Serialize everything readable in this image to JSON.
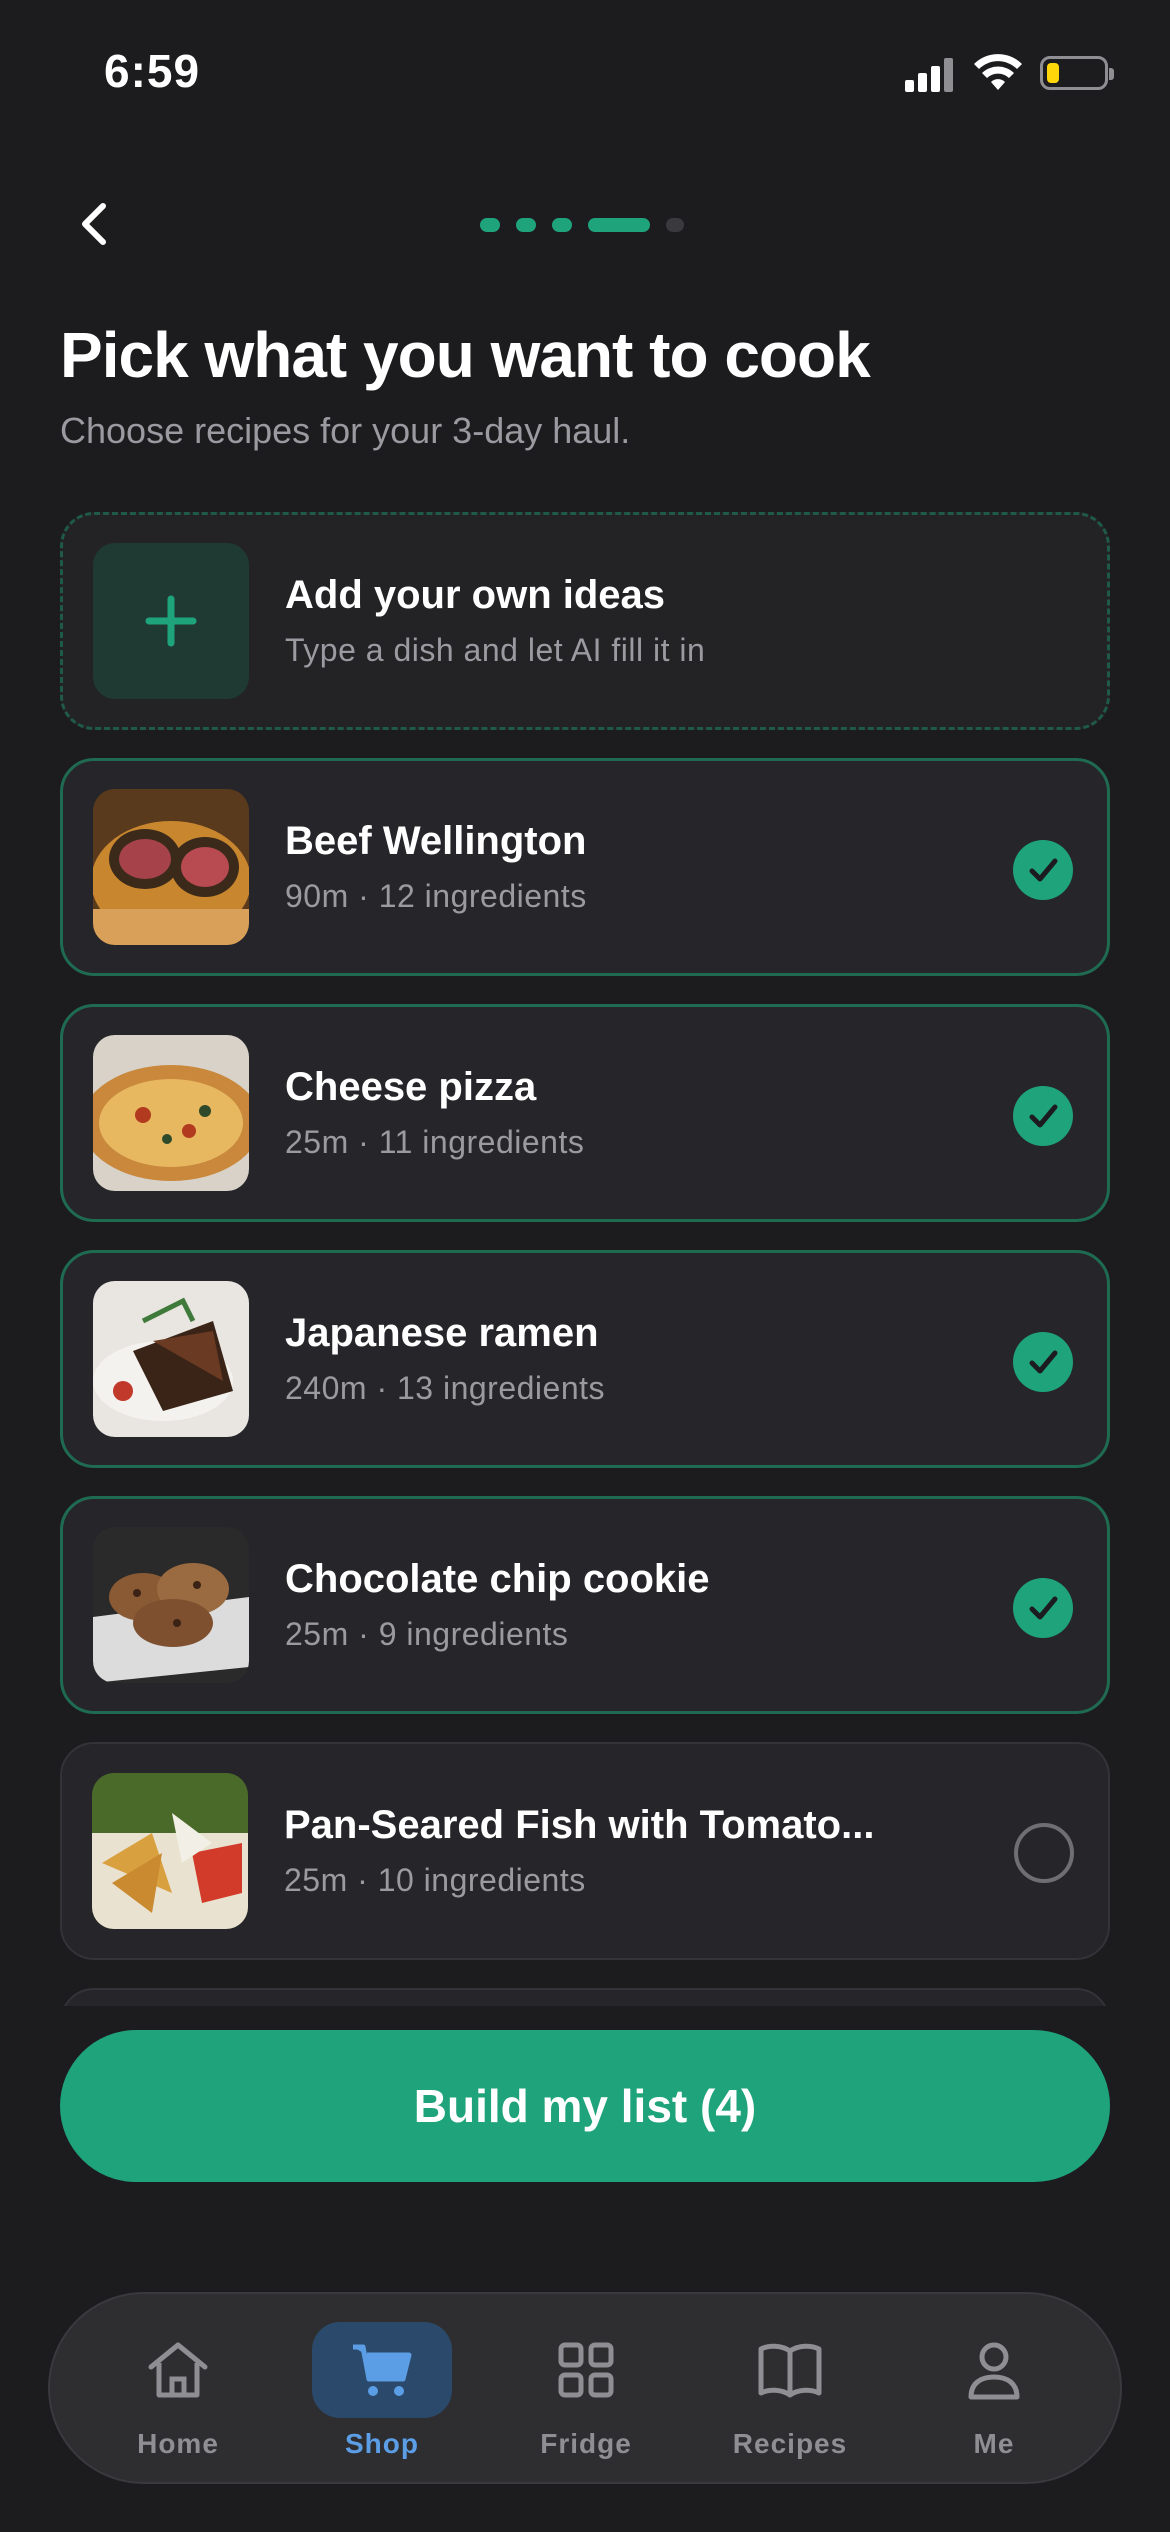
{
  "status_bar": {
    "time": "6:59"
  },
  "header": {
    "title": "Pick what you want to cook",
    "subtitle": "Choose recipes for your 3-day haul.",
    "progress": {
      "total_steps": 5,
      "current_step": 4
    }
  },
  "add_card": {
    "title": "Add your own ideas",
    "subtitle": "Type a dish and let AI fill it in"
  },
  "recipes": [
    {
      "name": "Beef Wellington",
      "meta": "90m · 12 ingredients",
      "selected": true
    },
    {
      "name": "Cheese pizza",
      "meta": "25m · 11 ingredients",
      "selected": true
    },
    {
      "name": "Japanese ramen",
      "meta": "240m · 13 ingredients",
      "selected": true
    },
    {
      "name": "Chocolate chip cookie",
      "meta": "25m · 9 ingredients",
      "selected": true
    },
    {
      "name": "Pan-Seared Fish with Tomato...",
      "meta": "25m · 10 ingredients",
      "selected": false
    }
  ],
  "cta": {
    "label": "Build my list (4)"
  },
  "tabbar": {
    "items": [
      {
        "label": "Home",
        "icon": "house-icon",
        "active": false
      },
      {
        "label": "Shop",
        "icon": "cart-icon",
        "active": true
      },
      {
        "label": "Fridge",
        "icon": "grid-icon",
        "active": false
      },
      {
        "label": "Recipes",
        "icon": "book-icon",
        "active": false
      },
      {
        "label": "Me",
        "icon": "person-icon",
        "active": false
      }
    ]
  },
  "colors": {
    "background": "#1c1c1e",
    "accent": "#1fa37a",
    "active_tab": "#5b9ee6",
    "card": "#26262a"
  }
}
